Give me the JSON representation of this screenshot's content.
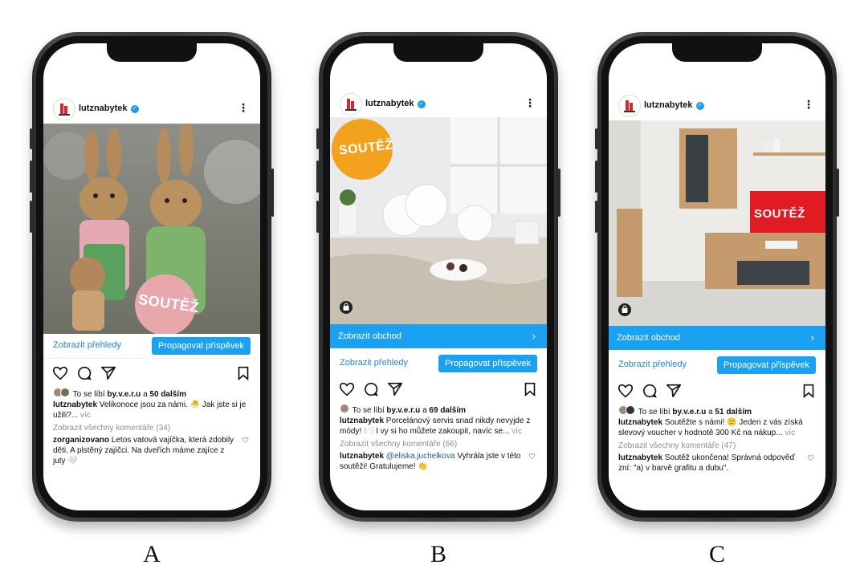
{
  "panels": [
    {
      "label": "A",
      "username": "lutznabytek",
      "badge": "SOUTĚŽ",
      "insights": "Zobrazit přehledy",
      "promote": "Propagovat příspěvek",
      "likes_prefix": "To se líbí",
      "likes_user": "by.v.e.r.u",
      "likes_mid": "a",
      "likes_count": "50 dalším",
      "caption_user": "lutznabytek",
      "caption_text": "Velikonoce jsou za námi. 🐣 Jak jste si je užili?...",
      "more": "víc",
      "comments_link": "Zobrazit všechny komentáře (34)",
      "comment_user": "zorganizovano",
      "comment_text": "Letos vatová vajíčka, která zdobily děti. A plstěný zajíčci. Na dveřích máme zajíce z juty 🤍"
    },
    {
      "label": "B",
      "username": "lutznabytek",
      "badge": "SOUTĚŽ",
      "shop": "Zobrazit obchod",
      "insights": "Zobrazit přehledy",
      "promote": "Propagovat příspěvek",
      "likes_prefix": "To se líbí",
      "likes_user": "by.v.e.r.u",
      "likes_mid": "a",
      "likes_count": "69 dalším",
      "caption_user": "lutznabytek",
      "caption_text": "Porcelánový servis snad nikdy nevyjde z módy! 🍽️ I vy si ho můžete zakoupit, navíc se...",
      "more": "víc",
      "comments_link": "Zobrazit všechny komentáře (66)",
      "comment_user": "lutznabytek",
      "comment_mention": "@eliska.juchelkova",
      "comment_text": "Vyhrála jste v této soutěži! Gratulujeme! 👏"
    },
    {
      "label": "C",
      "username": "lutznabytek",
      "badge": "SOUTĚŽ",
      "shop": "Zobrazit obchod",
      "insights": "Zobrazit přehledy",
      "promote": "Propagovat příspěvek",
      "likes_prefix": "To se líbí",
      "likes_user": "by.v.e.r.u",
      "likes_mid": "a",
      "likes_count": "51 dalším",
      "caption_user": "lutznabytek",
      "caption_text": "Soutěžte s námi! 🙂 Jeden z vás získá slevový voucher v hodnotě 300 Kč na nákup...",
      "more": "víc",
      "comments_link": "Zobrazit všechny komentáře (47)",
      "comment_user": "lutznabytek",
      "comment_text": "Soutěž ukončena! Správná odpověď zní: \"a) v barvě grafitu a dubu\"."
    }
  ],
  "colors": {
    "instagram_blue": "#1ba1f2",
    "link_blue": "#1b85d9",
    "badge_pink": "#e8a6ad",
    "badge_orange": "#f3a21e",
    "badge_red": "#e01a22"
  },
  "icons": [
    "heart-icon",
    "comment-icon",
    "share-icon",
    "bookmark-icon",
    "more-icon",
    "verified-icon",
    "shopping-bag-icon"
  ]
}
